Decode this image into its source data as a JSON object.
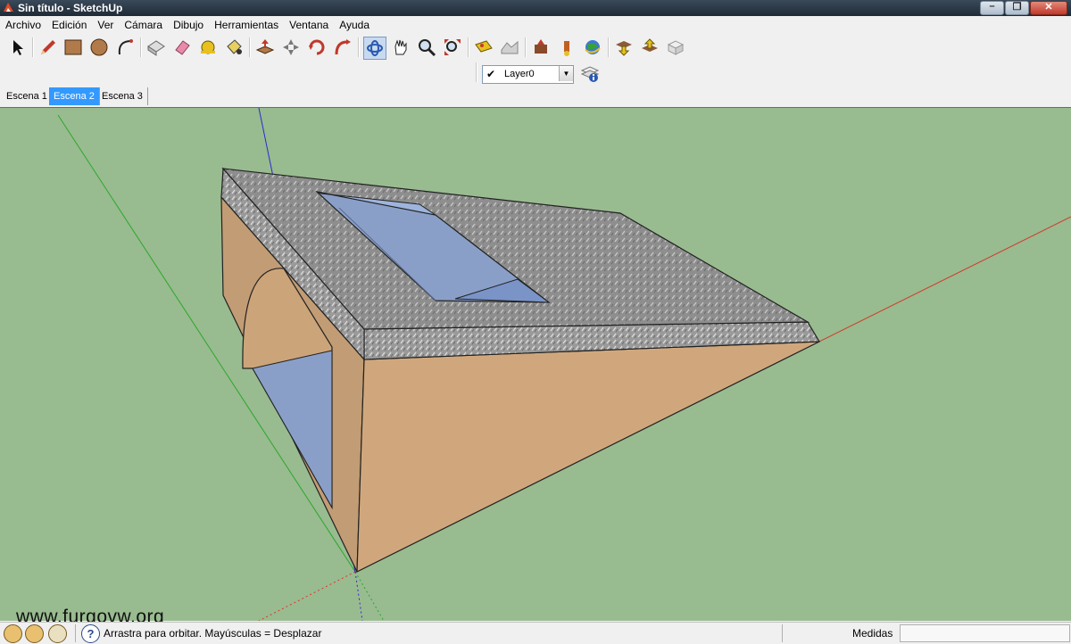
{
  "window": {
    "title": "Sin título - SketchUp"
  },
  "menu": [
    "Archivo",
    "Edición",
    "Ver",
    "Cámara",
    "Dibujo",
    "Herramientas",
    "Ventana",
    "Ayuda"
  ],
  "toolbar": {
    "tools": [
      {
        "name": "select-icon"
      },
      {
        "name": "pencil-icon"
      },
      {
        "name": "rectangle-icon"
      },
      {
        "name": "circle-icon"
      },
      {
        "name": "arc-icon"
      },
      {
        "name": "make-component-icon"
      },
      {
        "name": "eraser-icon"
      },
      {
        "name": "tape-measure-icon"
      },
      {
        "name": "paint-bucket-icon"
      },
      {
        "name": "push-pull-icon"
      },
      {
        "name": "move-icon"
      },
      {
        "name": "rotate-icon"
      },
      {
        "name": "follow-me-icon"
      },
      {
        "name": "orbit-icon"
      },
      {
        "name": "pan-icon"
      },
      {
        "name": "zoom-icon"
      },
      {
        "name": "zoom-extents-icon"
      },
      {
        "name": "add-location-icon"
      },
      {
        "name": "toggle-terrain-icon"
      },
      {
        "name": "get-models-icon"
      },
      {
        "name": "share-model-icon"
      },
      {
        "name": "share-component-icon"
      },
      {
        "name": "google-earth-icon"
      },
      {
        "name": "download-icon"
      },
      {
        "name": "upload-icon"
      },
      {
        "name": "component-icon"
      }
    ]
  },
  "layers": {
    "current": "Layer0",
    "check": "✔"
  },
  "scenes": [
    {
      "label": "Escena 1",
      "active": false
    },
    {
      "label": "Escena 2",
      "active": true
    },
    {
      "label": "Escena 3",
      "active": false
    }
  ],
  "watermark": "www.furgovw.org",
  "status": {
    "message": "Arrastra para orbitar. Mayúsculas = Desplazar",
    "measure_label": "Medidas",
    "measure_value": ""
  },
  "colors": {
    "viewport_bg": "#99bb90",
    "side_face": "#caa57b",
    "top_face": "#8c8c8c",
    "glass": "#8a9fc8",
    "axis_red": "#d23a2a",
    "axis_green": "#2aa82a",
    "axis_blue": "#2a2ad2",
    "active_tab": "#3399ff"
  }
}
